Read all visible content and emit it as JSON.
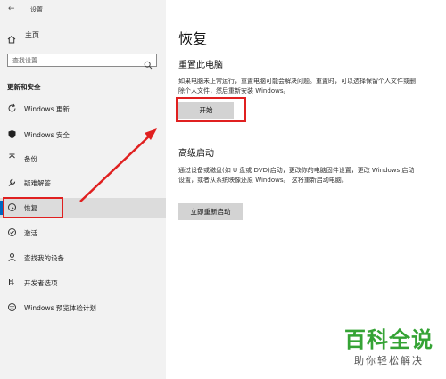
{
  "window": {
    "title": "设置"
  },
  "sidebar": {
    "home_label": "主页",
    "search_placeholder": "查找设置",
    "section_title": "更新和安全",
    "items": [
      {
        "label": "Windows 更新",
        "icon": "refresh-icon"
      },
      {
        "label": "Windows 安全",
        "icon": "shield-icon"
      },
      {
        "label": "备份",
        "icon": "backup-arrow-icon"
      },
      {
        "label": "疑难解答",
        "icon": "wrench-icon"
      },
      {
        "label": "恢复",
        "icon": "history-icon",
        "active": true
      },
      {
        "label": "激活",
        "icon": "check-circle-icon"
      },
      {
        "label": "查找我的设备",
        "icon": "person-pin-icon"
      },
      {
        "label": "开发者选项",
        "icon": "developer-icon"
      },
      {
        "label": "Windows 预览体验计划",
        "icon": "smiley-icon"
      }
    ]
  },
  "main": {
    "title": "恢复",
    "reset": {
      "heading": "重置此电脑",
      "description": "如果电脑未正常运行，重置电脑可能会解决问题。重置时，可以选择保留个人文件或删除个人文件，然后重新安装 Windows。",
      "button": "开始"
    },
    "advanced": {
      "heading": "高级启动",
      "description": "通过设备或磁盘(如 U 盘或 DVD)启动，更改你的电脑固件设置，更改 Windows 启动设置，或者从系统映像还原 Windows。 这将重新启动电脑。",
      "button": "立即重新启动"
    }
  },
  "watermark": {
    "main": "百科全说",
    "sub": "助你轻松解决"
  },
  "colors": {
    "highlight": "#e02020",
    "accent": "#0067c0",
    "watermark": "#35a335"
  }
}
